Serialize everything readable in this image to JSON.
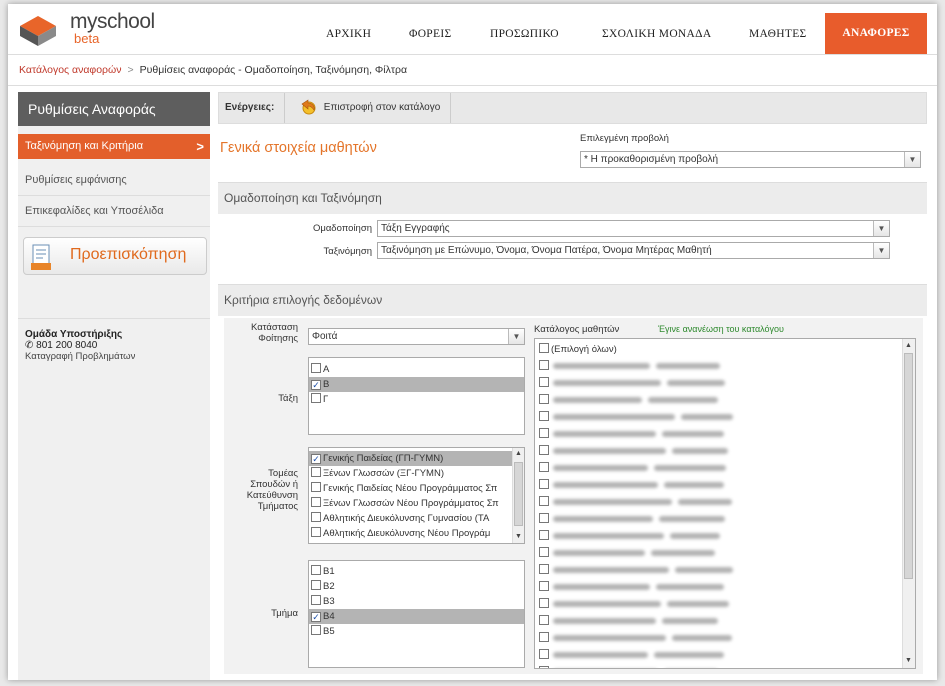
{
  "app": {
    "logo_text": "myschool",
    "logo_sub": "beta"
  },
  "nav": {
    "items": [
      "ΑΡΧΙΚΗ",
      "ΦΟΡΕΙΣ",
      "ΠΡΟΣΩΠΙΚΟ",
      "ΣΧΟΛΙΚΗ ΜΟΝΑΔΑ",
      "ΜΑΘΗΤΕΣ",
      "ΑΝΑΦΟΡΕΣ"
    ],
    "active": "ΑΝΑΦΟΡΕΣ"
  },
  "breadcrumb": {
    "link": "Κατάλογος αναφορών",
    "separator": ">",
    "current": "Ρυθμίσεις αναφοράς - Ομαδοποίηση, Ταξινόμηση, Φίλτρα"
  },
  "sidebar": {
    "title": "Ρυθμίσεις Αναφοράς",
    "items": [
      {
        "label": "Ταξινόμηση και Κριτήρια",
        "active": true,
        "chevron": ">"
      },
      {
        "label": "Ρυθμίσεις εμφάνισης",
        "active": false
      },
      {
        "label": "Επικεφαλίδες και Υποσέλιδα",
        "active": false
      }
    ],
    "preview_label": "Προεπισκόπηση",
    "support": {
      "title": "Ομάδα Υποστήριξης",
      "phone": "801 200 8040",
      "link": "Καταγραφή Προβλημάτων"
    }
  },
  "actions": {
    "label": "Ενέργειες:",
    "back_label": "Επιστροφή στον κατάλογο"
  },
  "general": {
    "title": "Γενικά στοιχεία μαθητών",
    "view_label": "Επιλεγμένη προβολή",
    "view_value": "* Η προκαθορισμένη προβολή"
  },
  "grouping": {
    "section_title": "Ομαδοποίηση και Ταξινόμηση",
    "group_label": "Ομαδοποίηση",
    "group_value": "Τάξη Εγγραφής",
    "sort_label": "Ταξινόμηση",
    "sort_value": "Ταξινόμηση με Επώνυμο, Όνομα, Όνομα Πατέρα, Όνομα Μητέρας Μαθητή"
  },
  "criteria": {
    "section_title": "Κριτήρια επιλογής δεδομένων",
    "status_label_1": "Κατάσταση",
    "status_label_2": "Φοίτησης",
    "status_value": "Φοιτά",
    "class_label": "Τάξη",
    "classes": [
      {
        "label": "Α",
        "checked": false
      },
      {
        "label": "Β",
        "checked": true
      },
      {
        "label": "Γ",
        "checked": false
      }
    ],
    "sector_label_lines": [
      "Τομέας",
      "Σπουδών ή",
      "Κατεύθυνση",
      "Τμήματος"
    ],
    "sectors": [
      {
        "label": "Γενικής Παιδείας (ΓΠ-ΓΥΜΝ)",
        "checked": true
      },
      {
        "label": "Ξένων Γλωσσών (ΞΓ-ΓΥΜΝ)",
        "checked": false
      },
      {
        "label": "Γενικής Παιδείας Νέου Προγράμματος Σπ",
        "checked": false
      },
      {
        "label": "Ξένων Γλωσσών Νέου Προγράμματος Σπ",
        "checked": false
      },
      {
        "label": "Αθλητικής Διευκόλυνσης Γυμνασίου (ΤΑ",
        "checked": false
      },
      {
        "label": "Αθλητικής Διευκόλυνσης Νέου Προγράμ",
        "checked": false
      }
    ],
    "section_label": "Τμήμα",
    "sections": [
      {
        "label": "Β1",
        "checked": false
      },
      {
        "label": "Β2",
        "checked": false
      },
      {
        "label": "Β3",
        "checked": false
      },
      {
        "label": "Β4",
        "checked": true
      },
      {
        "label": "Β5",
        "checked": false
      }
    ],
    "students_label": "Κατάλογος μαθητών",
    "refresh_msg": "Έγινε ανανέωση του καταλόγου",
    "select_all": "(Επιλογή όλων)",
    "student_rows": 20
  },
  "colors": {
    "accent": "#e85c2c",
    "sidebar_title_bg": "#5e5e5e",
    "link": "#c0392b",
    "section_title": "#e4752a"
  }
}
